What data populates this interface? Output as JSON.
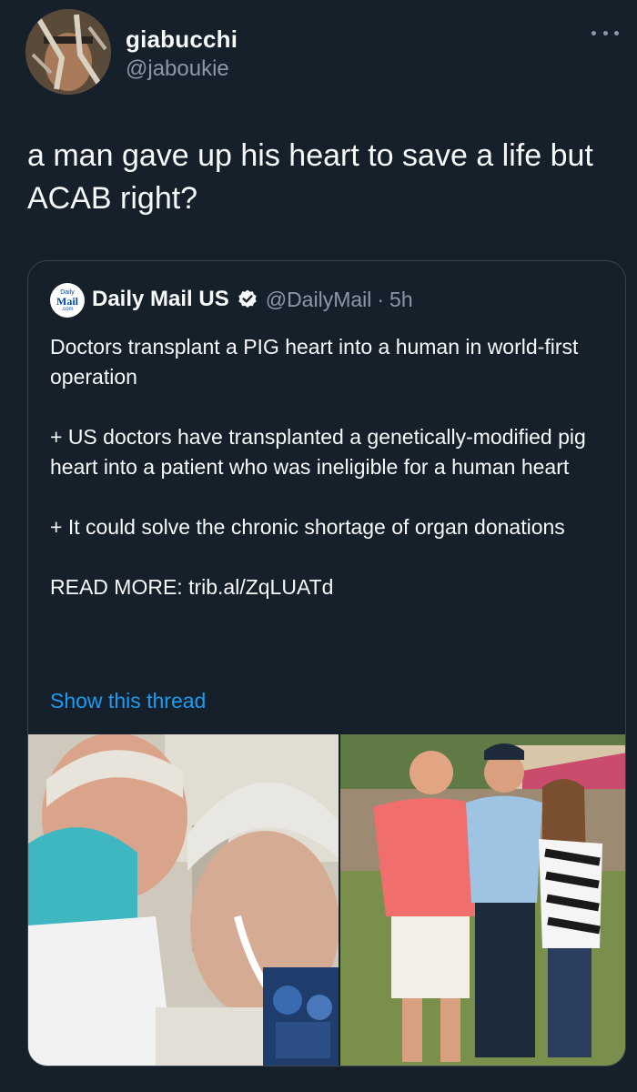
{
  "tweet": {
    "author": {
      "name": "giabucchi",
      "handle": "@jaboukie"
    },
    "text": "a man gave up his heart to save a life but ACAB right?"
  },
  "quoted": {
    "logo": {
      "line1": "Daily",
      "line2": "Mail",
      "line3": ".com"
    },
    "author": {
      "name": "Daily Mail US",
      "handle": "@DailyMail",
      "separator": "·",
      "time": "5h"
    },
    "paragraphs": [
      "Doctors transplant a PIG heart into a human in world-first operation",
      "+ US doctors have transplanted a genetically-modified pig heart into a patient who was ineligible for a human heart",
      "+ It could solve the chronic shortage of organ donations",
      "READ MORE: trib.al/ZqLUATd"
    ],
    "show_thread": "Show this thread"
  },
  "colors": {
    "background": "#15202b",
    "link": "#1d9bf0",
    "secondary_text": "#8b98a5",
    "border": "#38444d"
  },
  "icons": [
    "more-icon",
    "verified-badge-icon"
  ]
}
